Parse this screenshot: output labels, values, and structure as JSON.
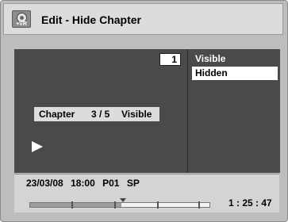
{
  "header": {
    "title": "Edit - Hide Chapter",
    "icon": "dvd-vr-icon",
    "icon_tag": "+VR"
  },
  "preview": {
    "chapter_number": "1",
    "chapter_label": "Chapter",
    "chapter_position": "3 / 5",
    "chapter_status": "Visible",
    "play_icon": "play-icon"
  },
  "menu": {
    "options": [
      {
        "label": "Visible",
        "selected": false
      },
      {
        "label": "Hidden",
        "selected": true
      }
    ]
  },
  "info": {
    "date": "23/03/08",
    "time": "18:00",
    "program": "P01",
    "mode": "SP"
  },
  "playback": {
    "elapsed": "1 : 25 : 47",
    "progress": 0.51
  },
  "colors": {
    "panel_dark": "#4a4a4a",
    "panel_light": "#d4d4d4",
    "highlight": "#ffffff"
  }
}
